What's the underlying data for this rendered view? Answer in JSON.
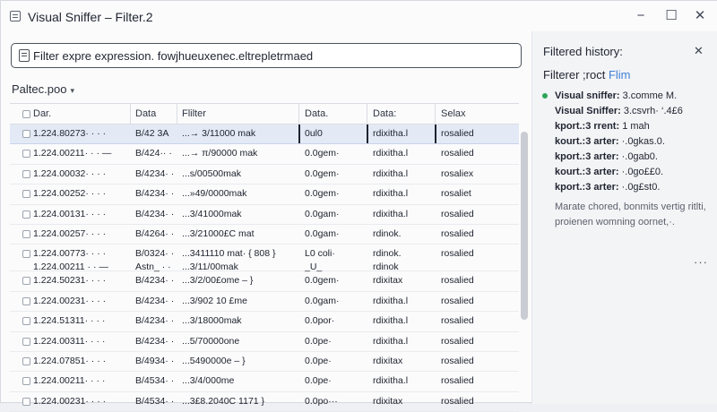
{
  "window": {
    "title": "Visual Sniffer – Filter.2",
    "minimize": "−",
    "maximize": "☐",
    "close": "✕"
  },
  "filter": {
    "value": "Filter expre expression. fowjhueuxenec.eltrepletrmaed",
    "icon": "filter-icon"
  },
  "protocol": {
    "label": "Paltec.poo",
    "caret": "▾"
  },
  "table": {
    "headers": [
      "Dar.",
      "Data",
      "Flilter",
      "Data.",
      "Data:",
      "Selax"
    ],
    "rows": [
      {
        "c1": "1.224.80273· · · ·",
        "c2": "B/42 3A",
        "c3": "...→ 3/11000 mak",
        "c4": "0ul0",
        "c5": "rdixitha.l",
        "c6": "rosalied",
        "selected": true
      },
      {
        "c1": "1.224.00211· · · —",
        "c2": "B/424·· ·",
        "c3": "...→ π/90000 mak",
        "c4": "0.0gem·",
        "c5": "rdixitha.l",
        "c6": "rosalied"
      },
      {
        "c1": "1.224.00032· · · ·",
        "c2": "B/4234· ·",
        "c3": "...s/00500mak",
        "c4": "0.0gem·",
        "c5": "rdixitha.l",
        "c6": "rosaliex"
      },
      {
        "c1": "1.224.00252· · · ·",
        "c2": "B/4234· ·",
        "c3": "...»49/0000mak",
        "c4": "0.0gem·",
        "c5": "rdixitha.l",
        "c6": "rosaliet"
      },
      {
        "c1": "1.224.00131· · · ·",
        "c2": "B/4234· ·",
        "c3": "...3/41000mak",
        "c4": "0.0gam·",
        "c5": "rdixitha.l",
        "c6": "rosalied"
      },
      {
        "c1": "1.224.00257· · · ·",
        "c2": "B/4264· ·",
        "c3": "...3/21000£C mat",
        "c4": "0.0gam·",
        "c5": "rdinok.",
        "c6": "rosalied"
      },
      {
        "c1": "1.224.00773· · · ·",
        "c1b": "1.224.00211 · · —",
        "c2": "B/0324· ·",
        "c2b": "Astn_ · ·",
        "c3": "...3411110 mat· { 808 }",
        "c3b": "...3/11/00mak",
        "c4": "L0 coli·",
        "c4b": "_U_",
        "c5": "rdinok.",
        "c5b": "rdinok",
        "c6": "rosalied",
        "tall": true
      },
      {
        "c1": "1.224.50231· · · ·",
        "c2": "B/4234· ·",
        "c3": "...3/2/00£ome – }",
        "c4": "0.0gem·",
        "c5": "rdixitax",
        "c6": "rosalied"
      },
      {
        "c1": "1.224.00231· · · ·",
        "c2": "B/4234· ·",
        "c3": "...3/902 10 £me",
        "c4": "0.0gam·",
        "c5": "rdixitha.l",
        "c6": "rosalied"
      },
      {
        "c1": "1.224.51311· · · ·",
        "c2": "B/4234· ·",
        "c3": "...3/18000mak",
        "c4": "0.0por·",
        "c5": "rdixitha.l",
        "c6": "rosalied"
      },
      {
        "c1": "1.224.00311· · · ·",
        "c2": "B/4234· ·",
        "c3": "...5/70000one",
        "c4": "0.0pe·",
        "c5": "rdixitha.l",
        "c6": "rosalied"
      },
      {
        "c1": "1.224.07851· · · ·",
        "c2": "B/4934· ·",
        "c3": "...5490000e – }",
        "c4": "0.0pe·",
        "c5": "rdixitax",
        "c6": "rosalied"
      },
      {
        "c1": "1.224.00211· · · ·",
        "c2": "B/4534· ·",
        "c3": "...3/4/000me",
        "c4": "0.0pe·",
        "c5": "rdixitha.l",
        "c6": "rosalied"
      },
      {
        "c1": "1.224.00231· · · ·",
        "c2": "B/4534· ·",
        "c3": "...3£8.2040C 1171 }",
        "c4": "0.0po···",
        "c5": "rdixitax",
        "c6": "rosalied"
      }
    ]
  },
  "sidebar": {
    "title": "Filtered history:",
    "close": "✕",
    "subtitle_main": "Filterer ;roct",
    "subtitle_accent": "Flim",
    "items": [
      {
        "label": "Visual sniffer:",
        "value": "3.comme M."
      },
      {
        "label": "Visual Sniffer:",
        "value": "3.csvrh· ‘.4£6"
      },
      {
        "label": "kport.:3 rrent:",
        "value": "1 mah"
      },
      {
        "label": "kourt.:3 arter:",
        "value": "·.0gkas.0."
      },
      {
        "label": "kport.:3 arter:",
        "value": "·.0gab0."
      },
      {
        "label": "kourt.:3 arter:",
        "value": "·.0go££0."
      },
      {
        "label": "kport.:3 arter:",
        "value": "·.0g£st0."
      }
    ],
    "note": "Marate chored, bonmits vertig ritlti, proienen womning oornet,·.",
    "more": "···",
    "dot_color": "#2fa55a",
    "accent_color": "#3f7fd6"
  }
}
